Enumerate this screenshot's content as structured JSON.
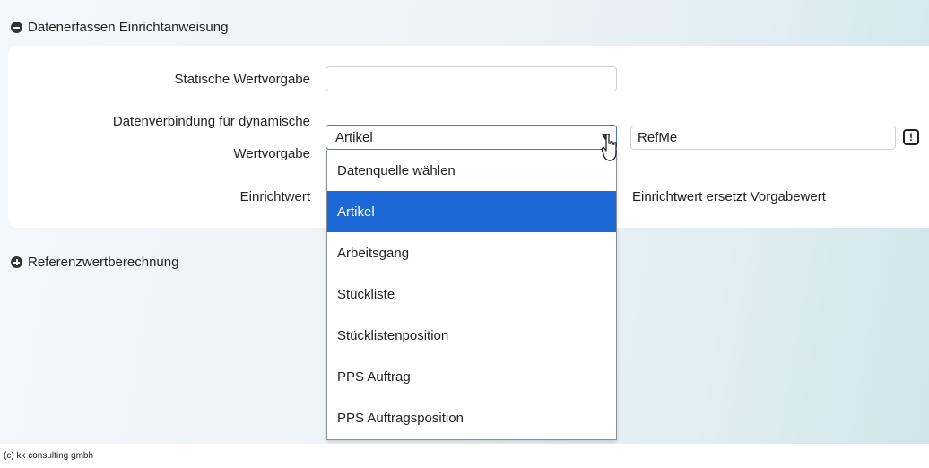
{
  "sections": {
    "setup": {
      "title": "Datenerfassen Einrichtanweisung",
      "toggle": "minus-circle-icon"
    },
    "reference": {
      "title": "Referenzwertberechnung",
      "toggle": "plus-circle-icon"
    }
  },
  "form": {
    "static_label": "Statische Wertvorgabe",
    "static_value": "",
    "dynamic_label_line1": "Datenverbindung für dynamische",
    "dynamic_label_line2": "Wertvorgabe",
    "dynamic_select_value": "Artikel",
    "ref_field_value": "RefMe",
    "setup_value_label": "Einrichtwert",
    "replace_hint": "Einrichtwert ersetzt Vorgabewert"
  },
  "dropdown": {
    "options": [
      "Datenquelle wählen",
      "Artikel",
      "Arbeitsgang",
      "Stückliste",
      "Stücklistenposition",
      "PPS Auftrag",
      "PPS Auftragsposition"
    ],
    "selected_index": 1,
    "selected_color": "#1c68d6"
  },
  "footer": {
    "copyright": "(c) kk consulting gmbh"
  }
}
